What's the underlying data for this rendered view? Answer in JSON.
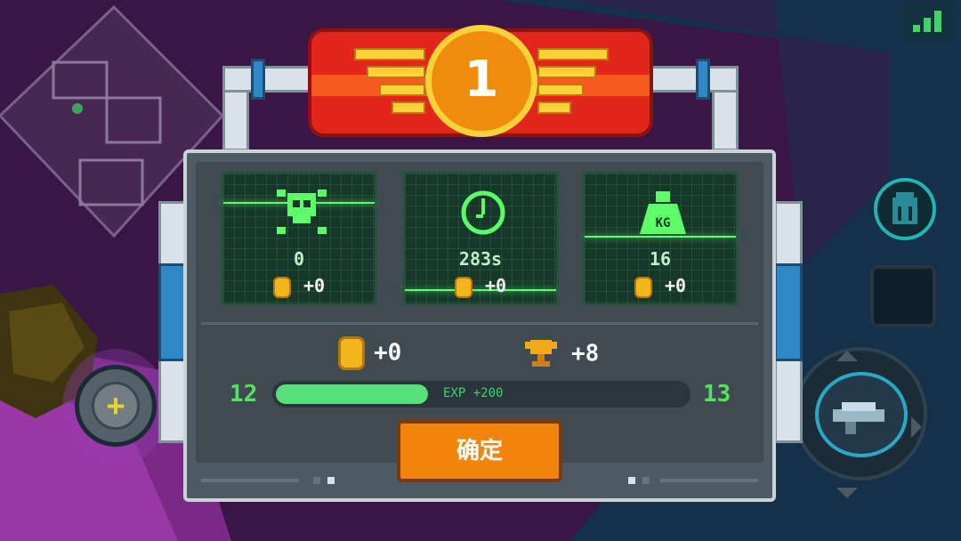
{
  "rank": "1",
  "stats": [
    {
      "icon": "skull-icon",
      "value": "0",
      "coin_reward": "+0"
    },
    {
      "icon": "clock-icon",
      "value": "283s",
      "coin_reward": "+0"
    },
    {
      "icon": "weight-icon",
      "icon_label": "KG",
      "value": "16",
      "coin_reward": "+0"
    }
  ],
  "rewards": {
    "coins": "+0",
    "trophy": "+8"
  },
  "level": {
    "current": "12",
    "next": "13",
    "exp_label": "EXP +200",
    "progress": 0.37
  },
  "confirm_label": "确定",
  "colors": {
    "accent_green": "#3fd36a",
    "banner_red": "#e3261c",
    "confirm_orange": "#f0840c",
    "gold": "#f2b51a"
  }
}
